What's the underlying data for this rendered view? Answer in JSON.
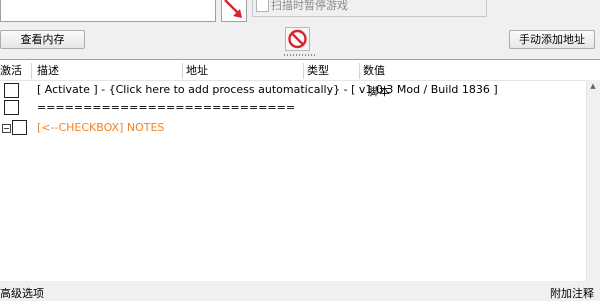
{
  "top": {
    "pause_checkbox_label": "扫描时暂停游戏",
    "pause_checked": false
  },
  "toolbar": {
    "view_memory_label": "查看内存",
    "add_address_manually_label": "手动添加地址",
    "stop_icon": "no-entry-icon",
    "arrow_icon": "red-arrow-icon"
  },
  "table": {
    "columns": [
      "激活",
      "描述",
      "地址",
      "类型",
      "数值"
    ],
    "rows": [
      {
        "description": "[ Activate ] - {Click here to add process automatically} - [ v1.0.3 Mod / Build 1836 ]",
        "value_overlap": "脚本",
        "checked": false
      },
      {
        "description": "============================",
        "checked": false
      },
      {
        "description": "[<--CHECKBOX] NOTES",
        "checked": false,
        "color": "#f58220",
        "expandable": true
      }
    ]
  },
  "footer": {
    "advanced_options_label": "高级选项",
    "add_comment_label": "附加注释"
  },
  "colors": {
    "accent_orange": "#f58220",
    "stop_red": "#d9232d",
    "arrow_red": "#d9232d"
  }
}
